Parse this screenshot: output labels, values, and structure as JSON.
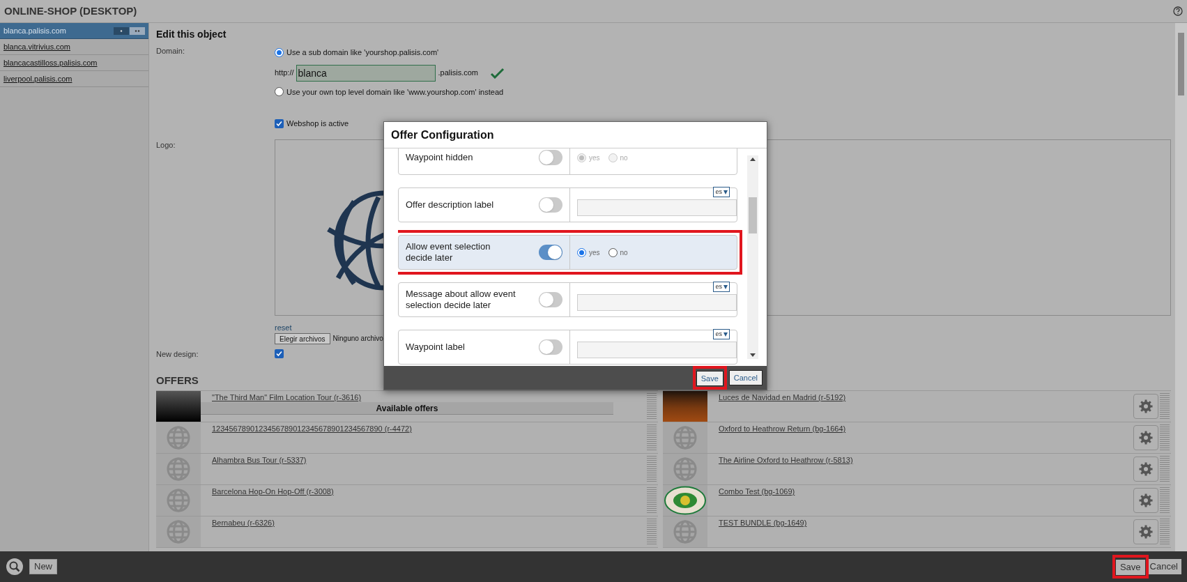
{
  "header": {
    "title": "ONLINE-SHOP (DESKTOP)"
  },
  "sidebar": {
    "items": [
      {
        "label": "blanca.palisis.com",
        "selected": true
      },
      {
        "label": "blanca.vitrivius.com",
        "selected": false
      },
      {
        "label": "blancacastilloss.palisis.com",
        "selected": false
      },
      {
        "label": "liverpool.palisis.com",
        "selected": false
      }
    ]
  },
  "form": {
    "title": "Edit this object",
    "domain_label": "Domain:",
    "subdomain_option": {
      "label": "Use a sub domain like 'yourshop.palisis.com'",
      "selected": true
    },
    "prefix": "http://",
    "subdomain_value": "blanca",
    "suffix": ".palisis.com",
    "valid": true,
    "own_domain_option": {
      "label": "Use your own top level domain like 'www.yourshop.com' instead",
      "selected": false
    },
    "active": {
      "label": "Webshop is active",
      "checked": true
    },
    "logo_label": "Logo:",
    "reset_link": "reset",
    "file_button": "Elegir archivos",
    "file_status": "Ninguno archivo",
    "new_design": {
      "label": "New design:",
      "checked": true
    }
  },
  "offers": {
    "title": "OFFERS",
    "overlay_label": "Available offers",
    "left": [
      {
        "label": "\"The Third Man\" Film Location Tour (r-3616)",
        "kind": "photo"
      },
      {
        "label": "1234567890123456789012345678901234567890 (r-4472)",
        "kind": "globe"
      },
      {
        "label": "Alhambra Bus Tour (r-5337)",
        "kind": "globe"
      },
      {
        "label": "Barcelona Hop-On Hop-Off (r-3008)",
        "kind": "globe"
      },
      {
        "label": "Bernabeu (r-6326)",
        "kind": "globe"
      }
    ],
    "right": [
      {
        "label": "Luces de Navidad en Madrid (r-5192)",
        "kind": "night"
      },
      {
        "label": "Oxford to Heathrow Return (bg-1664)",
        "kind": "globe"
      },
      {
        "label": "The Airline Oxford to Heathrow (r-5813)",
        "kind": "globe"
      },
      {
        "label": "Combo Test (bg-1069)",
        "kind": "logo"
      },
      {
        "label": "TEST BUNDLE (bg-1649)",
        "kind": "globe"
      }
    ]
  },
  "modal": {
    "title": "Offer Configuration",
    "settings": [
      {
        "label": "Waypoint hidden",
        "kind": "choice",
        "on": false,
        "disabled": true,
        "highlighted": false,
        "options": [
          {
            "label": "yes",
            "selected": true
          },
          {
            "label": "no",
            "selected": false
          }
        ]
      },
      {
        "label": "Offer description label",
        "kind": "text",
        "on": false,
        "highlighted": false,
        "language": "es"
      },
      {
        "label": "Allow event selection decide later",
        "kind": "choice",
        "on": true,
        "disabled": false,
        "highlighted": true,
        "options": [
          {
            "label": "yes",
            "selected": true
          },
          {
            "label": "no",
            "selected": false
          }
        ]
      },
      {
        "label": "Message about allow event selection decide later",
        "kind": "text",
        "on": false,
        "highlighted": false,
        "language": "es"
      },
      {
        "label": "Waypoint label",
        "kind": "text",
        "on": false,
        "highlighted": false,
        "language": "es"
      }
    ],
    "save_button": {
      "label": "Save",
      "highlighted": true
    },
    "cancel_button": "Cancel"
  },
  "footer": {
    "new_button": "New",
    "save_button": {
      "label": "Save",
      "highlighted": true
    },
    "cancel_button": "Cancel"
  }
}
